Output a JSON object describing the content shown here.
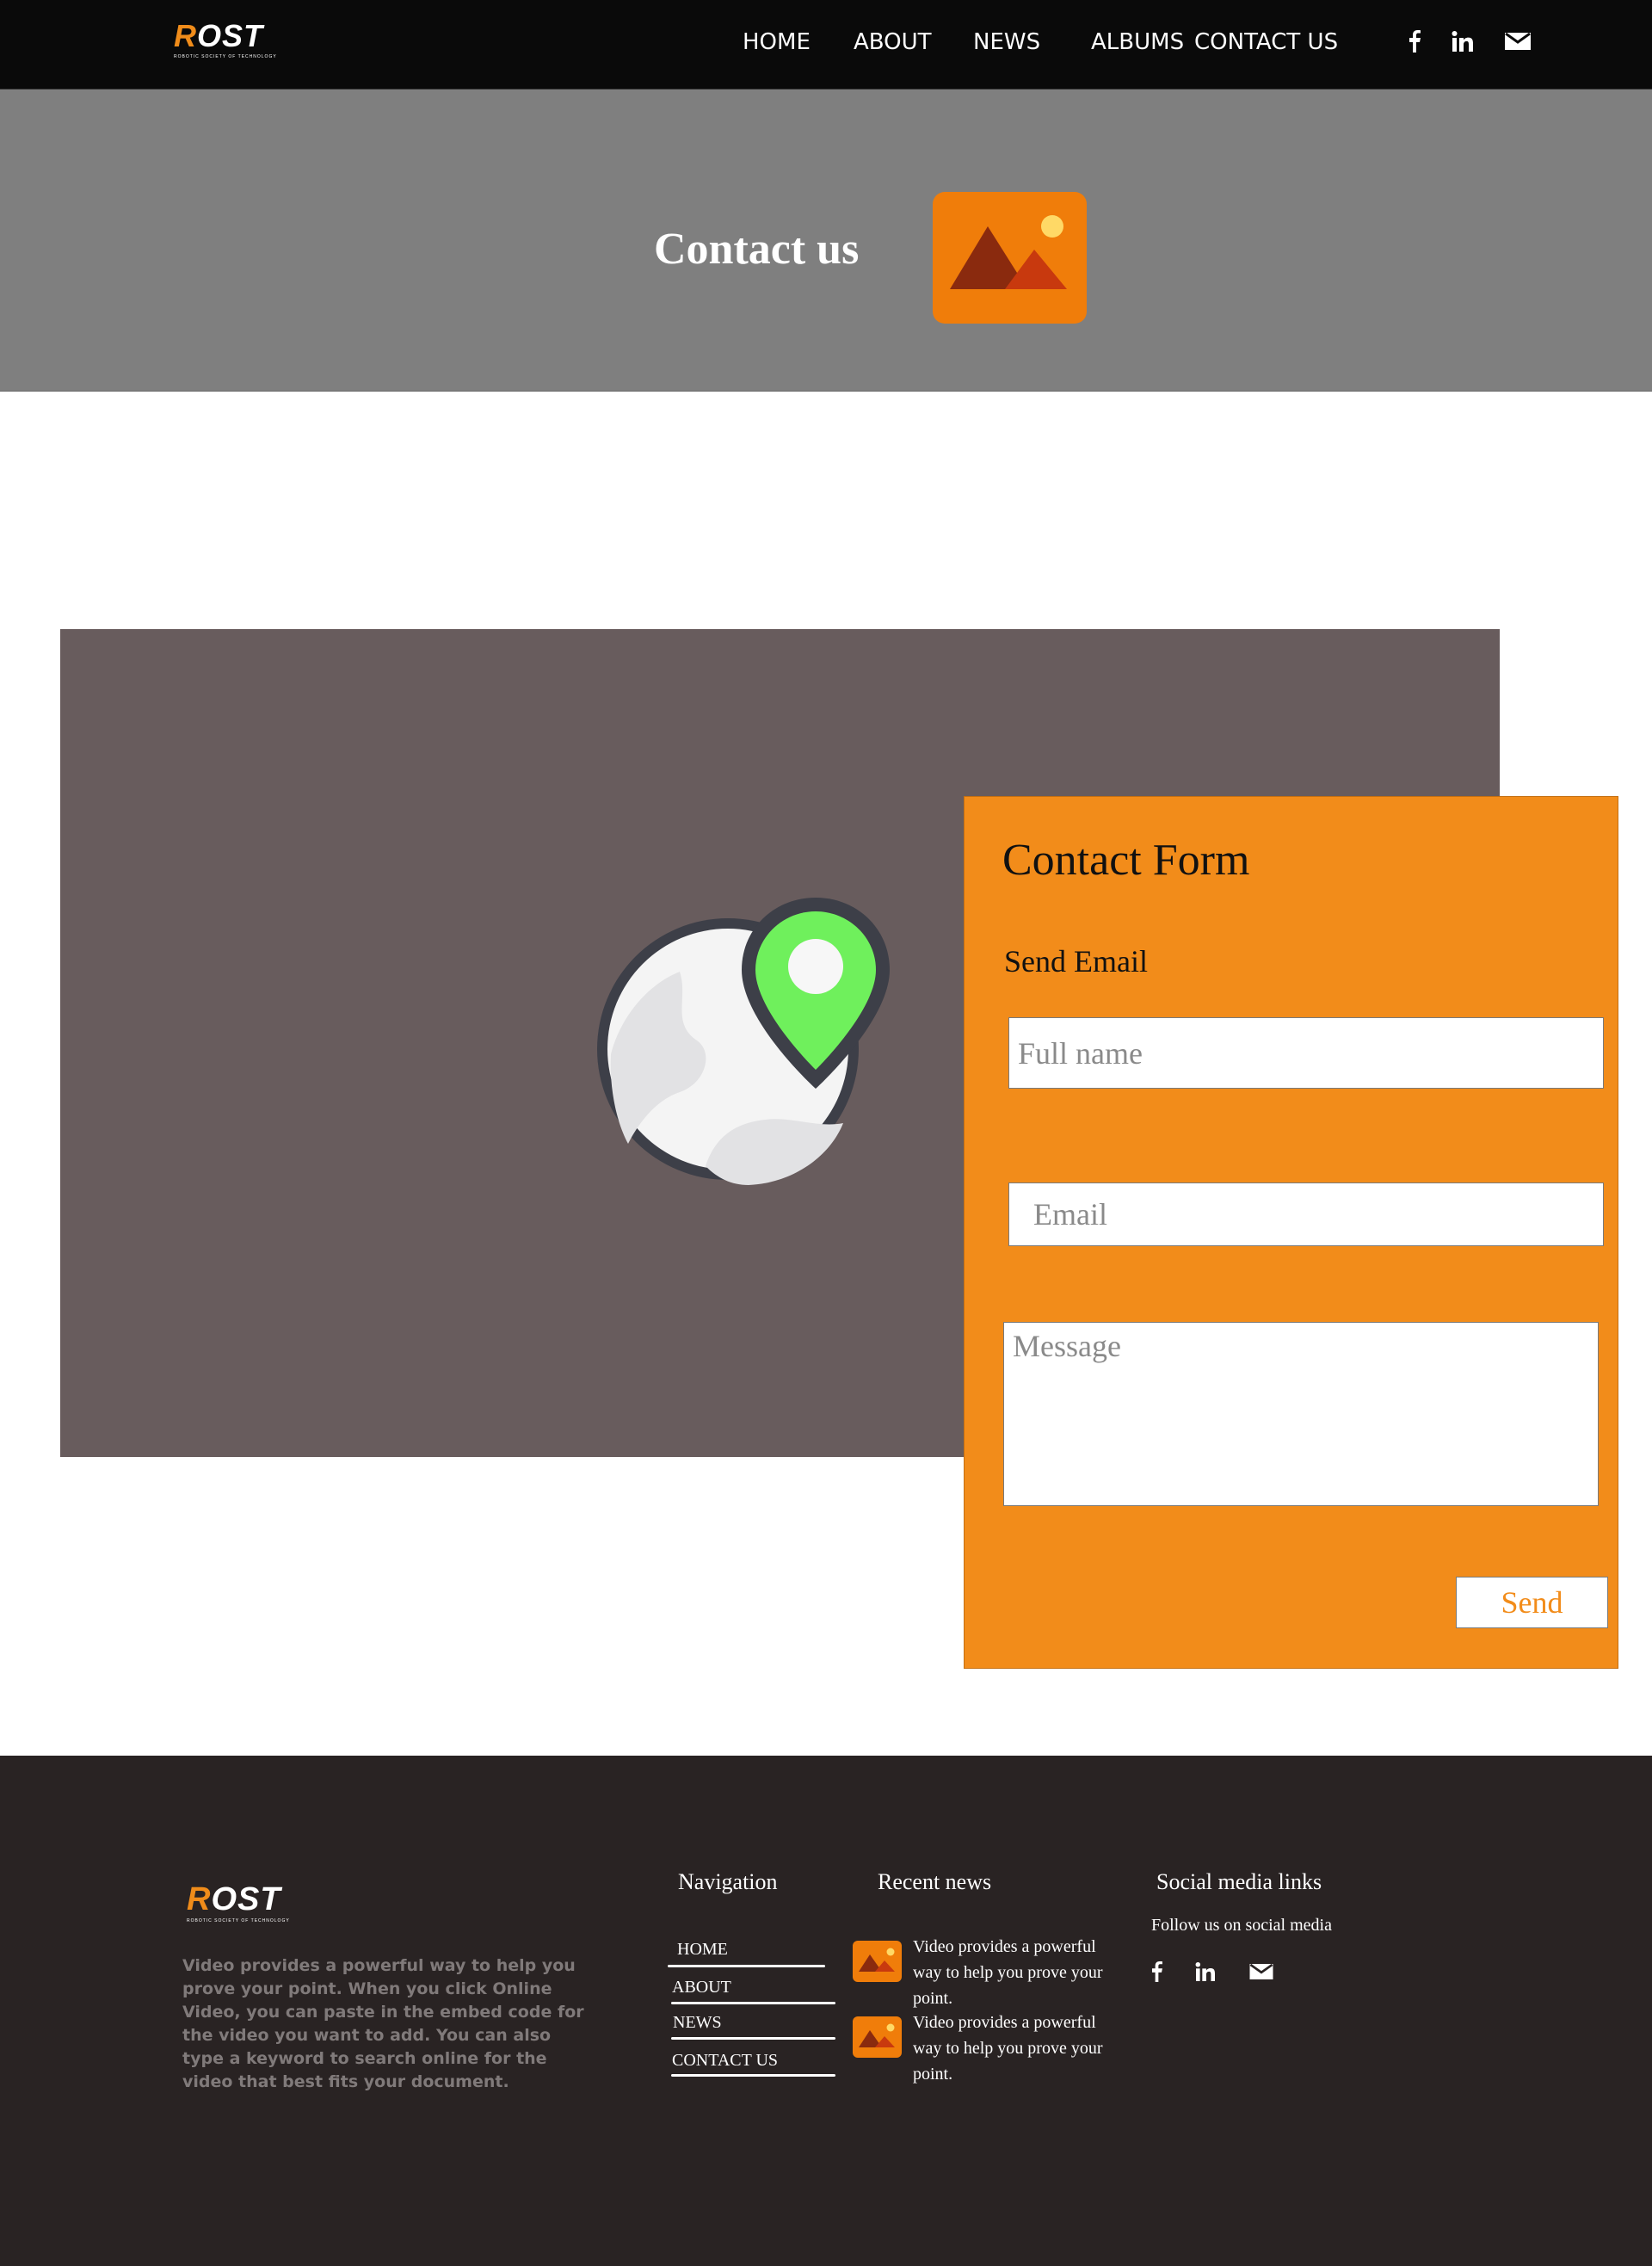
{
  "header": {
    "logo_text": "ROST",
    "logo_subtitle": "ROBOTIC SOCIETY OF TECHNOLOGY",
    "nav": [
      {
        "label": "HOME"
      },
      {
        "label": "ABOUT"
      },
      {
        "label": "NEWS"
      },
      {
        "label": "ALBUMS"
      },
      {
        "label": "CONTACT US"
      }
    ],
    "social_icons": [
      "facebook-icon",
      "linkedin-icon",
      "mail-icon"
    ]
  },
  "banner": {
    "title": "Contact us",
    "image_icon": "image-placeholder-icon"
  },
  "map": {
    "icon": "globe-location-pin-icon"
  },
  "contact_form": {
    "title": "Contact Form",
    "subtitle": "Send Email",
    "full_name_placeholder": "Full name",
    "email_placeholder": "Email",
    "message_placeholder": "Message",
    "send_label": "Send"
  },
  "footer": {
    "logo_text": "ROST",
    "logo_subtitle": "ROBOTIC SOCIETY OF TECHNOLOGY",
    "description": "Video provides a powerful way to help you prove your point. When you click Online Video, you can paste in the embed code for the video you want to add. You can also type a keyword to search online for the video that best fits your document.",
    "navigation_heading": "Navigation",
    "navigation_links": [
      {
        "label": "HOME"
      },
      {
        "label": "ABOUT"
      },
      {
        "label": "NEWS"
      },
      {
        "label": "CONTACT US"
      }
    ],
    "recent_news_heading": "Recent news",
    "recent_news": [
      {
        "text": "Video provides a powerful way to help you prove your point."
      },
      {
        "text": "Video provides a powerful way to help you prove your point."
      }
    ],
    "social_heading": "Social media links",
    "social_text": "Follow us on social media",
    "social_icons": [
      "facebook-icon",
      "linkedin-icon",
      "mail-icon"
    ]
  },
  "colors": {
    "accent": "#f28c1a",
    "header_bg": "#0a0a0a",
    "banner_bg": "#7f7f7f",
    "map_bg": "#685c5d",
    "footer_bg": "#292323"
  }
}
